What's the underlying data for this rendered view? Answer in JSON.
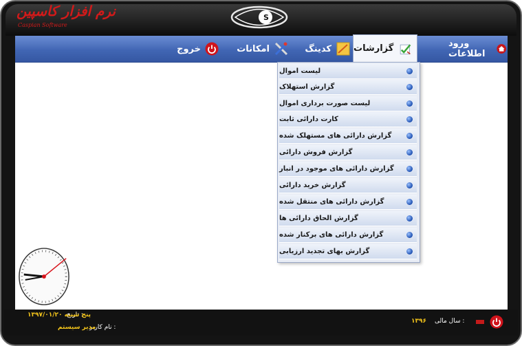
{
  "app": {
    "logo_text": "نرم افزار کاسپین",
    "logo_subtext": "Caspian Software"
  },
  "menu": {
    "items": [
      {
        "id": "login",
        "label": "ورود اطلاعات",
        "icon": "home-icon"
      },
      {
        "id": "reports",
        "label": "گزارشات",
        "icon": "report-check-icon",
        "active": true
      },
      {
        "id": "coding",
        "label": "کدینگ",
        "icon": "notepad-icon"
      },
      {
        "id": "tools",
        "label": "امکانات",
        "icon": "tools-icon"
      },
      {
        "id": "exit",
        "label": "خروج",
        "icon": "power-icon"
      }
    ]
  },
  "dropdown": {
    "items": [
      "لیست اموال",
      "گزارش استهلاک",
      "لیست صورت برداری اموال",
      "کارت دارائی ثابت",
      "گزارش دارائی های مستهلک شده",
      "گزارش فروش دارائی",
      "گزارش دارائی های موجود در انبار",
      "گزارش خرید دارائی",
      "گزارش دارائی های منتقل شده",
      "گزارش الحاق دارائی ها",
      "گزارش دارائی های برکنار شده",
      "گزارش بهای تجدید ارزیابی"
    ]
  },
  "status": {
    "date_label": "تاریخ :",
    "date_value": "پنج شنبه ۱۳۹۷/۰۱/۲۰",
    "user_label": "نام کاربر :",
    "user_value": "مدیر سیستم",
    "fiscal_year_label": "سال مالی :",
    "fiscal_year_value": "۱۳۹۶"
  },
  "colors": {
    "menubar": "#4166b4",
    "accent_red": "#d21a1a",
    "status_value": "#f3c41b",
    "frame": "#141414"
  }
}
